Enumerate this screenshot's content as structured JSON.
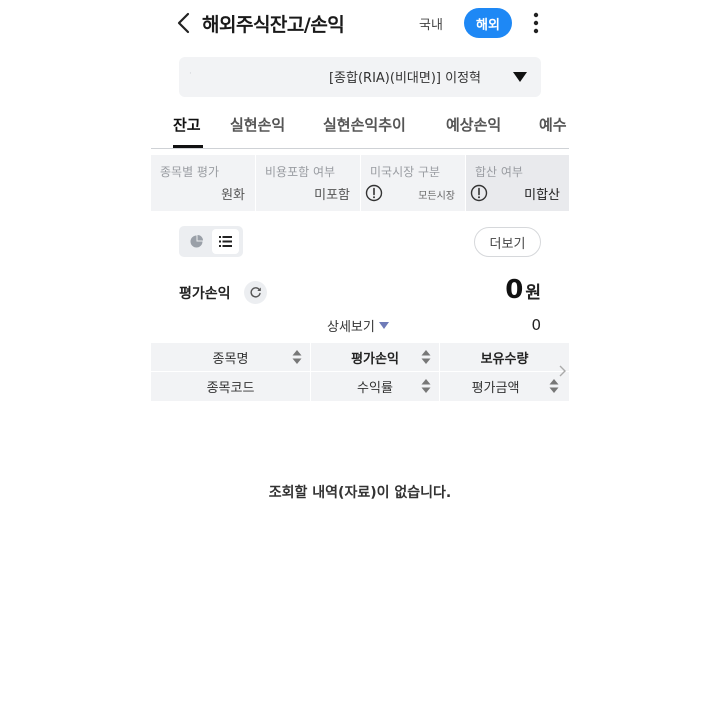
{
  "header": {
    "title": "해외주식잔고/손익",
    "tab_domestic": "국내",
    "tab_overseas": "해외"
  },
  "account": {
    "number": "·",
    "name": "[종합(RIA)(비대면)]  이정혁"
  },
  "subtabs": [
    "잔고",
    "실현손익",
    "실현손익추이",
    "예상손익",
    "예수"
  ],
  "filters": {
    "valuation_label": "종목별 평가",
    "valuation_value": "원화",
    "fee_label": "비용포함 여부",
    "fee_value": "미포함",
    "market_label": "미국시장 구분",
    "market_value": "모든시장",
    "sum_label": "합산 여부",
    "sum_value": "미합산"
  },
  "more_label": "더보기",
  "eval": {
    "label": "평가손익",
    "amount": "0",
    "unit": "원",
    "detail_label": "상세보기",
    "detail_value": "0"
  },
  "table": {
    "col1_top": "종목명",
    "col1_bottom": "종목코드",
    "col2_top": "평가손익",
    "col2_bottom": "수익률",
    "col3_top": "보유수량",
    "col3_bottom": "평가금액"
  },
  "empty_message": "조회할 내역(자료)이 없습니다.",
  "colors": {
    "accent": "#1e88f5",
    "panel": "#f2f3f5",
    "caret": "#6f7bb8"
  }
}
